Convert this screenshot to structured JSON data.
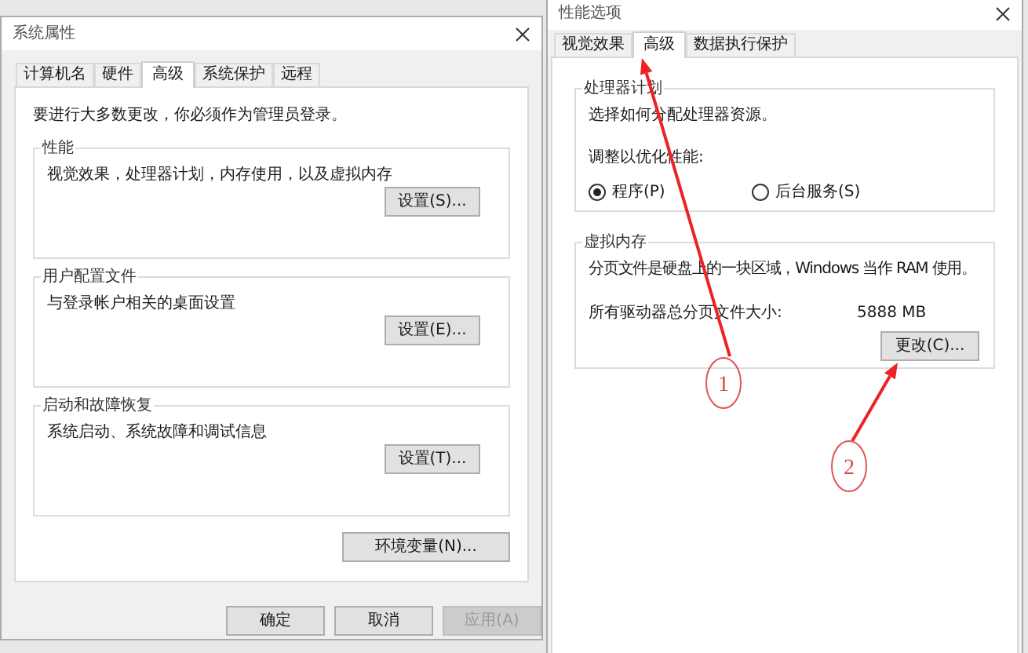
{
  "system_properties": {
    "title": "系统属性",
    "tabs": [
      {
        "label": "计算机名",
        "selected": false
      },
      {
        "label": "硬件",
        "selected": false
      },
      {
        "label": "高级",
        "selected": true
      },
      {
        "label": "系统保护",
        "selected": false
      },
      {
        "label": "远程",
        "selected": false
      }
    ],
    "notice": "要进行大多数更改，你必须作为管理员登录。",
    "groups": [
      {
        "title": "性能",
        "description": "视觉效果，处理器计划，内存使用，以及虚拟内存",
        "button": "设置(S)..."
      },
      {
        "title": "用户配置文件",
        "description": "与登录帐户相关的桌面设置",
        "button": "设置(E)..."
      },
      {
        "title": "启动和故障恢复",
        "description": "系统启动、系统故障和调试信息",
        "button": "设置(T)..."
      }
    ],
    "env_button": "环境变量(N)...",
    "footer_buttons": [
      {
        "label": "确定",
        "disabled": false
      },
      {
        "label": "取消",
        "disabled": false
      },
      {
        "label": "应用(A)",
        "disabled": true
      }
    ]
  },
  "performance_options": {
    "title": "性能选项",
    "tabs": [
      {
        "label": "视觉效果",
        "selected": false
      },
      {
        "label": "高级",
        "selected": true
      },
      {
        "label": "数据执行保护",
        "selected": false
      }
    ],
    "processor_group": {
      "title": "处理器计划",
      "description": "选择如何分配处理器资源。",
      "adjust_label": "调整以优化性能:",
      "options": [
        {
          "label": "程序(P)",
          "selected": true
        },
        {
          "label": "后台服务(S)",
          "selected": false
        }
      ]
    },
    "virtual_memory": {
      "title": "虚拟内存",
      "description": "分页文件是硬盘上的一块区域，Windows 当作 RAM 使用。",
      "total_label": "所有驱动器总分页文件大小:",
      "total_value": "5888 MB",
      "button": "更改(C)..."
    }
  },
  "annotations": [
    {
      "label": "1"
    },
    {
      "label": "2"
    }
  ]
}
